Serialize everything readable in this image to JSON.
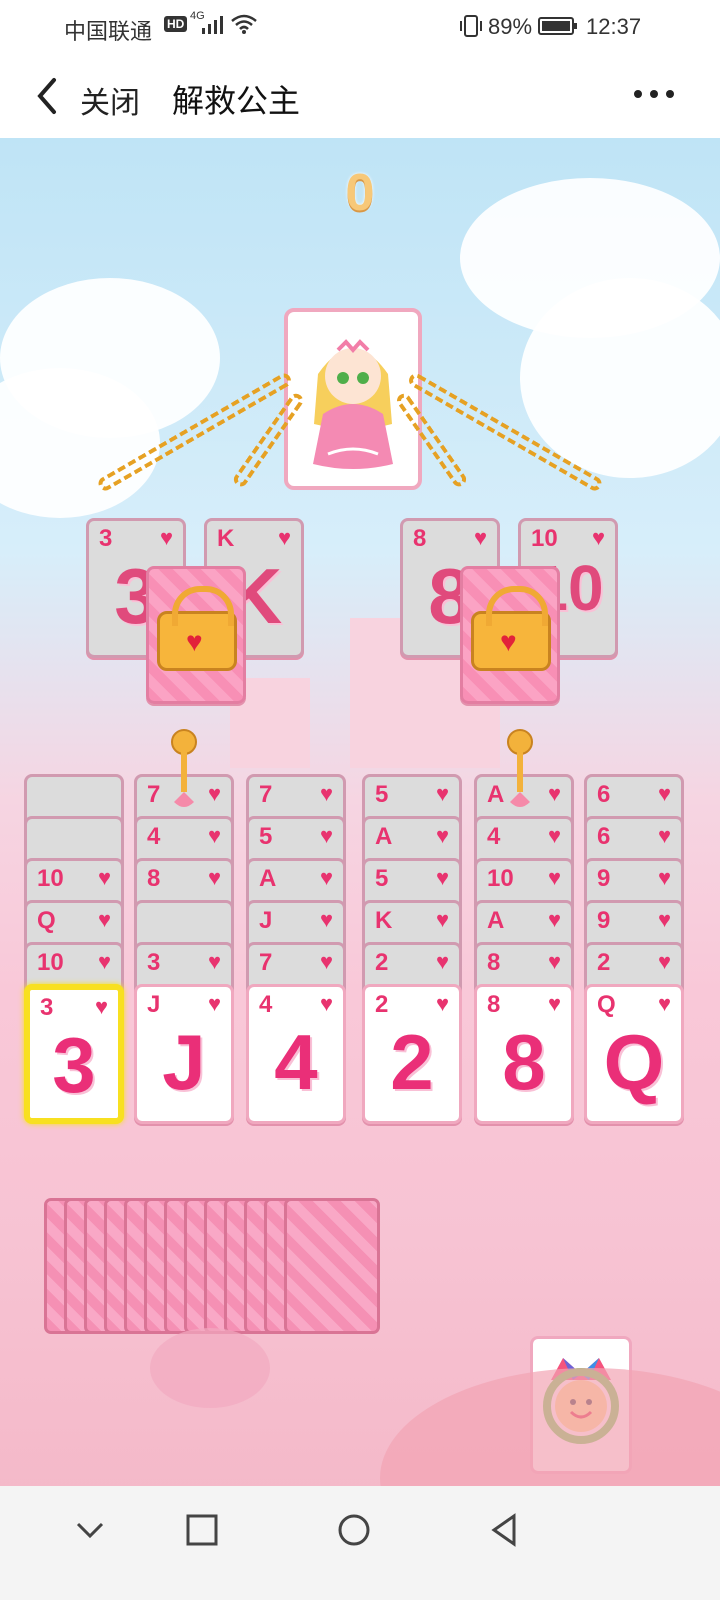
{
  "status": {
    "carrier": "中国联通",
    "hd": "HD",
    "network": "4G",
    "battery": "89%",
    "time": "12:37"
  },
  "nav": {
    "close_label": "关闭",
    "title": "解救公主"
  },
  "game": {
    "score": "0",
    "locked_cards": [
      {
        "rank": "3",
        "suit": "♥",
        "big": "3"
      },
      {
        "rank": "K",
        "suit": "♥",
        "big": "K"
      },
      {
        "rank": "8",
        "suit": "♥",
        "big": "8"
      },
      {
        "rank": "10",
        "suit": "♥",
        "big": "10"
      }
    ],
    "columns": [
      {
        "stack": [
          "",
          "",
          "10",
          "Q",
          "10"
        ],
        "top": {
          "rank": "3",
          "suit": "♥"
        }
      },
      {
        "stack": [
          "7",
          "4",
          "8",
          "",
          "3"
        ],
        "top": {
          "rank": "J",
          "suit": "♥"
        }
      },
      {
        "stack": [
          "7",
          "5",
          "A",
          "J",
          "7"
        ],
        "top": {
          "rank": "4",
          "suit": "♥"
        }
      },
      {
        "stack": [
          "5",
          "A",
          "5",
          "K",
          "2"
        ],
        "top": {
          "rank": "2",
          "suit": "♥"
        }
      },
      {
        "stack": [
          "A",
          "4",
          "10",
          "A",
          "8"
        ],
        "top": {
          "rank": "8",
          "suit": "♥"
        }
      },
      {
        "stack": [
          "6",
          "6",
          "9",
          "9",
          "2"
        ],
        "top": {
          "rank": "Q",
          "suit": "♥"
        }
      }
    ],
    "stock_count": 13
  }
}
